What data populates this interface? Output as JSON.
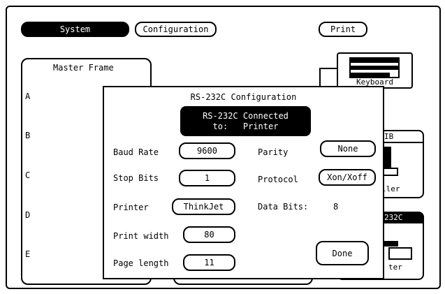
{
  "top_bar": {
    "system_label": "System",
    "configuration_label": "Configuration",
    "print_label": "Print"
  },
  "master_frame": {
    "title": "Master Frame",
    "slots": [
      "A",
      "B",
      "C",
      "D",
      "E"
    ]
  },
  "background_panels": {
    "keyboard_label": "Keyboard",
    "hpib_fragment": "IB",
    "controller_fragment": "ller",
    "rs232_fragment": "232C",
    "printer_fragment": "ter"
  },
  "dialog": {
    "title": "RS-232C Configuration",
    "connected_line1": "RS-232C Connected",
    "connected_line2": "to:   Printer",
    "baud_rate_label": "Baud Rate",
    "baud_rate_value": "9600",
    "stop_bits_label": "Stop Bits",
    "stop_bits_value": "1",
    "printer_label": "Printer",
    "printer_value": "ThinkJet",
    "print_width_label": "Print width",
    "print_width_value": "80",
    "page_length_label": "Page length",
    "page_length_value": "11",
    "parity_label": "Parity",
    "parity_value": "None",
    "protocol_label": "Protocol",
    "protocol_value": "Xon/Xoff",
    "data_bits_label": "Data Bits:",
    "data_bits_value": "8",
    "done_label": "Done"
  }
}
